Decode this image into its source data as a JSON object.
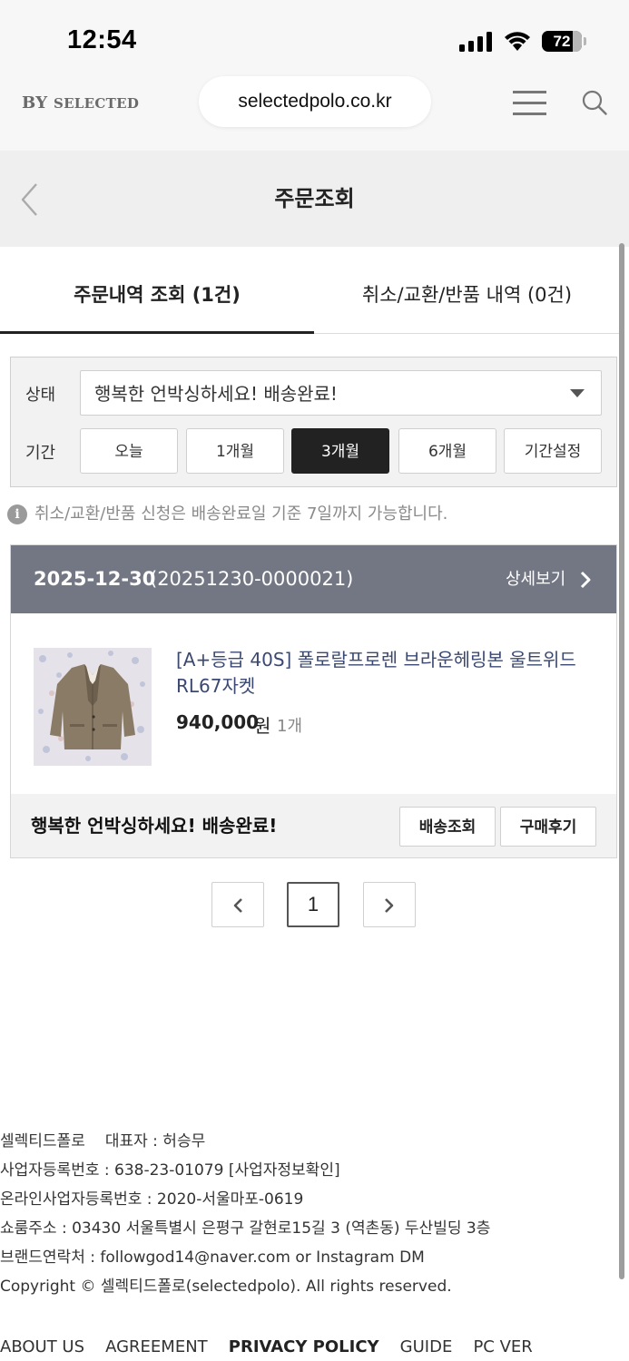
{
  "status_bar": {
    "time": "12:54",
    "battery": "72",
    "battery_level": 0.72,
    "icons": [
      "signal-icon",
      "wifi-icon",
      "battery-icon"
    ]
  },
  "browser": {
    "brand_prefix": "BY",
    "brand_suffix": "SELECTED",
    "url": "selectedpolo.co.kr",
    "icons": [
      "menu-icon",
      "search-icon"
    ]
  },
  "header": {
    "title": "주문조회",
    "back_icon": "chevron-left-icon"
  },
  "tabs": [
    {
      "label": "주문내역 조회 (1건)",
      "active": true
    },
    {
      "label": "취소/교환/반품 내역 (0건)",
      "active": false
    }
  ],
  "filter": {
    "status_label": "상태",
    "status_value": "행복한 언박싱하세요! 배송완료!",
    "period_label": "기간",
    "periods": [
      "오늘",
      "1개월",
      "3개월",
      "6개월",
      "기간설정"
    ],
    "selected_period": "3개월"
  },
  "notice": {
    "icon": "info-icon",
    "text": "취소/교환/반품 신청은 배송완료일 기준 7일까지 가능합니다."
  },
  "order": {
    "date": "2025-12-30",
    "order_number": "(20251230-0000021)",
    "detail_label": "상세보기",
    "product_name": "[A+등급 40S] 폴로랄프로렌 브라운헤링본 울트위드 RL67자켓",
    "price": "940,000",
    "price_unit": "원",
    "quantity": "1개",
    "status": "행복한 언박싱하세요! 배송완료!",
    "track_label": "배송조회",
    "review_label": "구매후기"
  },
  "pagination": {
    "current": "1",
    "prev_icon": "chevron-left-icon",
    "next_icon": "chevron-right-icon"
  },
  "footer": {
    "company": "셀렉티드폴로",
    "ceo": "대표자 : 허승무",
    "business_reg": "사업자등록번호 : 638-23-01079 [사업자정보확인]",
    "online_reg": "온라인사업자등록번호 : 2020-서울마포-0619",
    "address": "쇼룸주소 : 03430 서울특별시 은평구 갈현로15길 3 (역촌동) 두산빌딩 3층",
    "contact": "브랜드연락처 : followgod14@naver.com or Instagram DM",
    "copyright": "Copyright © 셀렉티드폴로(selectedpolo). All rights reserved.",
    "links": [
      "ABOUT US",
      "AGREEMENT",
      "PRIVACY POLICY",
      "GUIDE",
      "PC VER"
    ]
  },
  "colors": {
    "order_header": "#737784",
    "product_name": "#3b4872",
    "selected_period_bg": "#222222"
  }
}
